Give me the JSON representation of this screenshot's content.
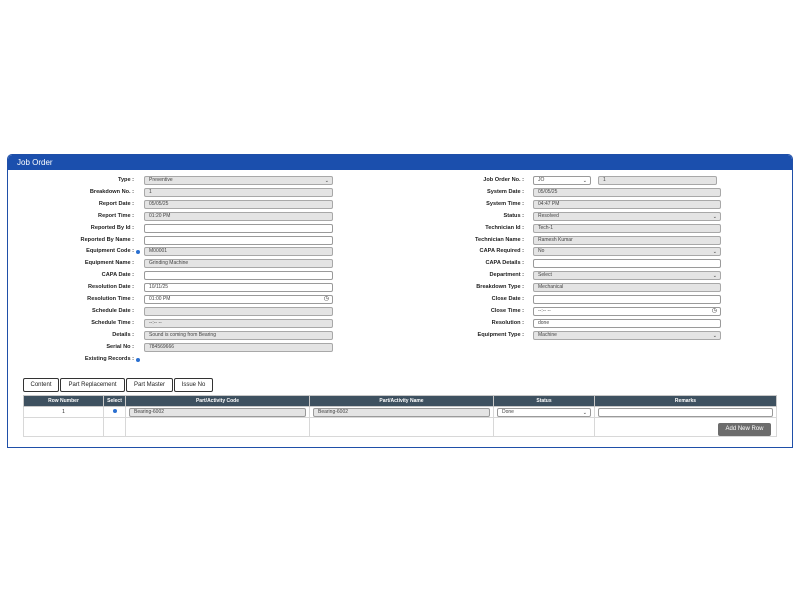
{
  "panel": {
    "title": "Job Order"
  },
  "left": [
    {
      "label": "Type :",
      "value": "Preventive",
      "kind": "select"
    },
    {
      "label": "Breakdown No. :",
      "value": "1",
      "kind": "ro"
    },
    {
      "label": "Report Date :",
      "value": "05/05/25",
      "kind": "ro"
    },
    {
      "label": "Report Time :",
      "value": "01:20 PM",
      "kind": "ro"
    },
    {
      "label": "Reported By Id :",
      "value": "",
      "kind": "input"
    },
    {
      "label": "Reported By Name :",
      "value": "",
      "kind": "input"
    },
    {
      "label": "Equipment Code :",
      "value": "M00001",
      "kind": "ro",
      "dot": true
    },
    {
      "label": "Equipment Name :",
      "value": "Grinding Machine",
      "kind": "ro"
    },
    {
      "label": "CAPA Date :",
      "value": "",
      "kind": "input"
    },
    {
      "label": "Resolution Date :",
      "value": "10/11/25",
      "kind": "input"
    },
    {
      "label": "Resolution Time :",
      "value": "01:00 PM",
      "kind": "time"
    },
    {
      "label": "Schedule Date :",
      "value": "",
      "kind": "ro"
    },
    {
      "label": "Schedule Time :",
      "value": "--:-- --",
      "kind": "timero"
    },
    {
      "label": "Details :",
      "value": "Sound is coming from Bearing",
      "kind": "ro"
    },
    {
      "label": "Serial No :",
      "value": "784569666",
      "kind": "ro"
    },
    {
      "label": "Existing Records :",
      "value": "",
      "kind": "dotonly"
    }
  ],
  "right": [
    {
      "label": "Job Order No. :",
      "value": "JO",
      "value2": "1",
      "kind": "jo"
    },
    {
      "label": "System Date :",
      "value": "05/05/25",
      "kind": "ro"
    },
    {
      "label": "System Time :",
      "value": "04:47 PM",
      "kind": "ro"
    },
    {
      "label": "Status :",
      "value": "Resolved",
      "kind": "select"
    },
    {
      "label": "Technician Id :",
      "value": "Tech-1",
      "kind": "ro"
    },
    {
      "label": "Technician Name :",
      "value": "Ramesh Kumar",
      "kind": "ro"
    },
    {
      "label": "CAPA Required :",
      "value": "No",
      "kind": "select"
    },
    {
      "label": "CAPA Details :",
      "value": "",
      "kind": "input"
    },
    {
      "label": "Department :",
      "value": "Select",
      "kind": "selectro"
    },
    {
      "label": "Breakdown Type :",
      "value": "Mechanical",
      "kind": "ro"
    },
    {
      "label": "Close Date :",
      "value": "",
      "kind": "input"
    },
    {
      "label": "Close Time :",
      "value": "--:-- --",
      "kind": "time"
    },
    {
      "label": "Resolution :",
      "value": "done",
      "kind": "input"
    },
    {
      "label": "Equipment Type :",
      "value": "Machine",
      "kind": "select"
    }
  ],
  "tabs": [
    "Content",
    "Part Replacement",
    "Part Master",
    "Issue No"
  ],
  "table": {
    "headers": [
      "Row Number",
      "Select",
      "Part/Activity Code",
      "Part/Activity Name",
      "Status",
      "Remarks"
    ],
    "rows": [
      {
        "row_number": "1",
        "code": "Bearing-6002",
        "name": "Bearing-6002",
        "status": "Done",
        "remarks": ""
      }
    ]
  },
  "add_button": "Add New Row"
}
